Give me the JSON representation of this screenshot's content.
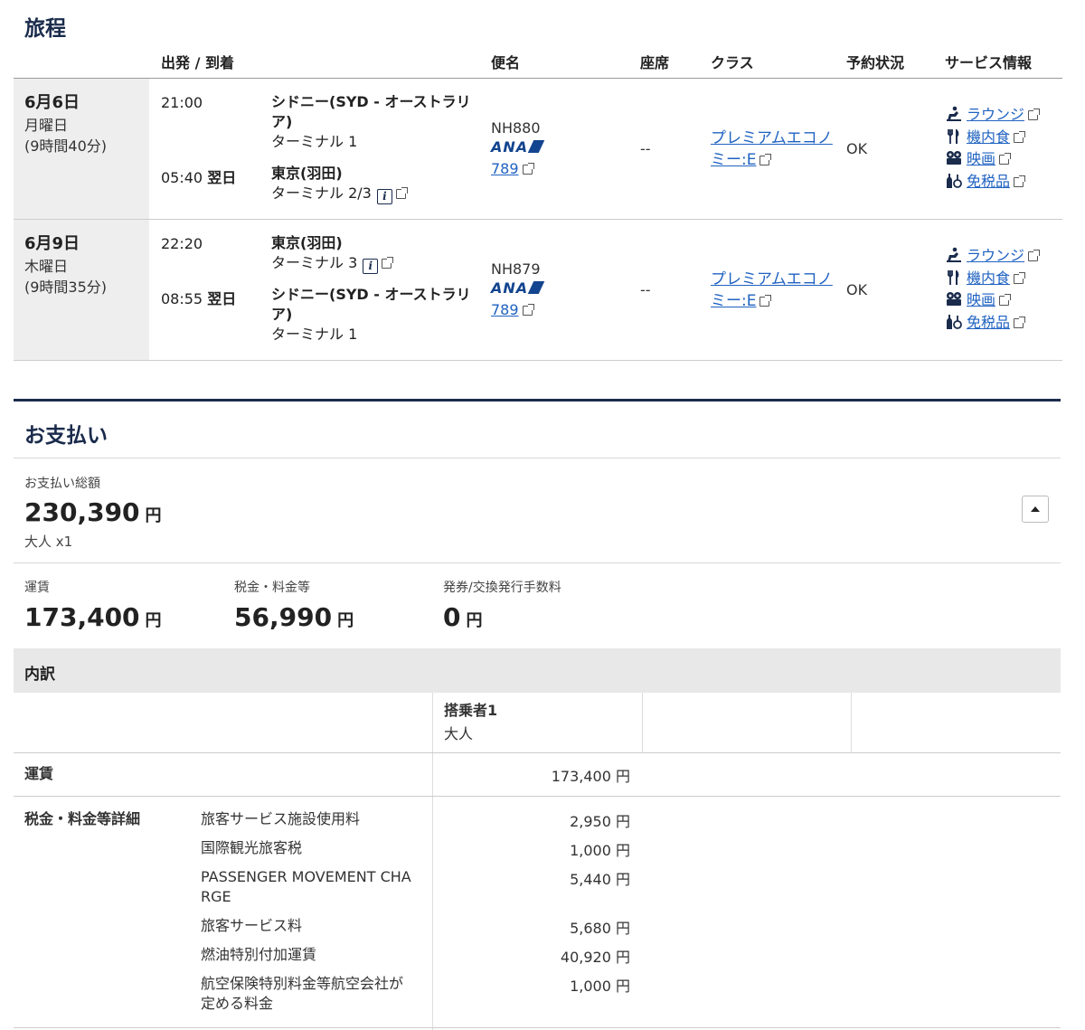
{
  "itinerary": {
    "title": "旅程",
    "headers": {
      "dep_arr": "出発 / 到着",
      "flight": "便名",
      "seat": "座席",
      "class": "クラス",
      "status": "予約状況",
      "service": "サービス情報"
    },
    "segments": [
      {
        "date": "6月6日",
        "weekday": "月曜日",
        "duration": "(9時間40分)",
        "dep_time": "21:00",
        "dep_city_l1": "シドニー(SYD - オーストラリ",
        "dep_city_l2": "ア)",
        "dep_terminal": "ターミナル 1",
        "arr_time": "05:40",
        "arr_next": "翌日",
        "arr_city": "東京(羽田)",
        "arr_terminal": "ターミナル 2/3",
        "flight_no": "NH880",
        "airline": "ANA",
        "aircraft": "789",
        "seat": "--",
        "class_l1": "プレミアムエコノ",
        "class_l2": "ミー:E",
        "status": "OK"
      },
      {
        "date": "6月9日",
        "weekday": "木曜日",
        "duration": "(9時間35分)",
        "dep_time": "22:20",
        "dep_city": "東京(羽田)",
        "dep_terminal": "ターミナル 3",
        "arr_time": "08:55",
        "arr_next": "翌日",
        "arr_city_l1": "シドニー(SYD - オーストラリ",
        "arr_city_l2": "ア)",
        "arr_terminal": "ターミナル 1",
        "flight_no": "NH879",
        "airline": "ANA",
        "aircraft": "789",
        "seat": "--",
        "class_l1": "プレミアムエコノ",
        "class_l2": "ミー:E",
        "status": "OK"
      }
    ],
    "services": {
      "lounge": "ラウンジ",
      "meal": "機内食",
      "movie": "映画",
      "dutyfree": "免税品"
    },
    "info_glyph": "i"
  },
  "payment": {
    "title": "お支払い",
    "total_label": "お支払い総額",
    "total_amount": "230,390",
    "yen": "円",
    "passengers": "大人 x1",
    "fare_label": "運賃",
    "fare_amount": "173,400",
    "tax_label": "税金・料金等",
    "tax_amount": "56,990",
    "fee_label": "発券/交換発行手数料",
    "fee_amount": "0",
    "breakdown": {
      "title": "内訳",
      "passenger_col": "搭乗者1",
      "passenger_type": "大人",
      "fare_row_label": "運賃",
      "fare_row_amount": "173,400 円",
      "tax_section_label": "税金・料金等詳細",
      "tax_items": [
        {
          "name": "旅客サービス施設使用料",
          "amount": "2,950 円"
        },
        {
          "name": "国際観光旅客税",
          "amount": "1,000 円"
        },
        {
          "name_l1": "PASSENGER MOVEMENT CHA",
          "name_l2": "RGE",
          "amount": "5,440 円"
        },
        {
          "name": "旅客サービス料",
          "amount": "5,680 円"
        },
        {
          "name": "燃油特別付加運賃",
          "amount": "40,920 円"
        },
        {
          "name_l1": "航空保険特別料金等航空会社が",
          "name_l2": "定める料金",
          "amount": "1,000 円"
        }
      ]
    }
  },
  "colors": {
    "navy": "#1a2b4c",
    "link": "#1f62c1",
    "ana_blue": "#13448f"
  }
}
